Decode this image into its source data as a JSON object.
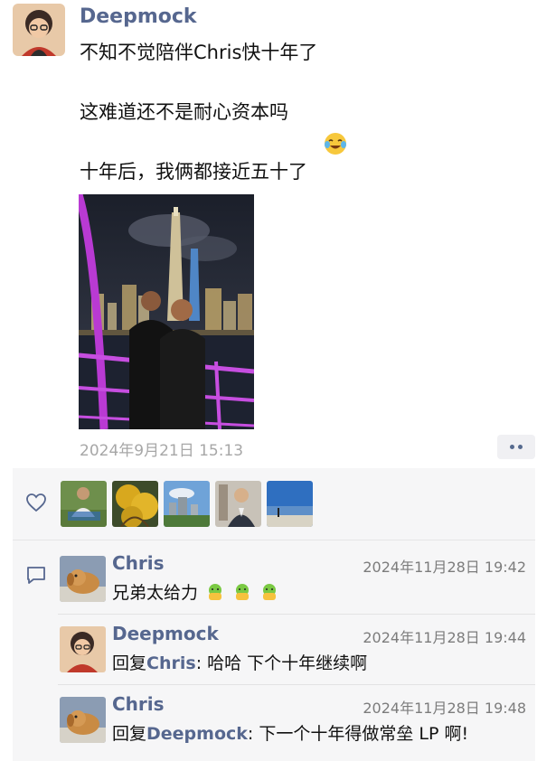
{
  "post": {
    "author": "Deepmock",
    "text": "不知不觉陪伴Chris快十年了\n\n这难道还不是耐心资本吗\n\n十年后，我俩都接近五十了",
    "timestamp": "2024年9月21日 15:13"
  },
  "likes": {
    "avatars": [
      "liker-1",
      "liker-2",
      "liker-3",
      "liker-4",
      "liker-5"
    ]
  },
  "comments": [
    {
      "author": "Chris",
      "time": "2024年11月28日 19:42",
      "text": "兄弟太给力",
      "emoji": "hug-emoji x3"
    },
    {
      "author": "Deepmock",
      "time": "2024年11月28日 19:44",
      "reply_prefix": "回复",
      "reply_to": "Chris",
      "text": ": 哈哈 下个十年继续啊"
    },
    {
      "author": "Chris",
      "time": "2024年11月28日 19:48",
      "reply_prefix": "回复",
      "reply_to": "Deepmock",
      "text": ": 下一个十年得做常垒 LP 啊!"
    }
  ],
  "colors": {
    "name": "#56678f",
    "panel": "#f6f6f7",
    "muted": "#a7a7a7"
  }
}
